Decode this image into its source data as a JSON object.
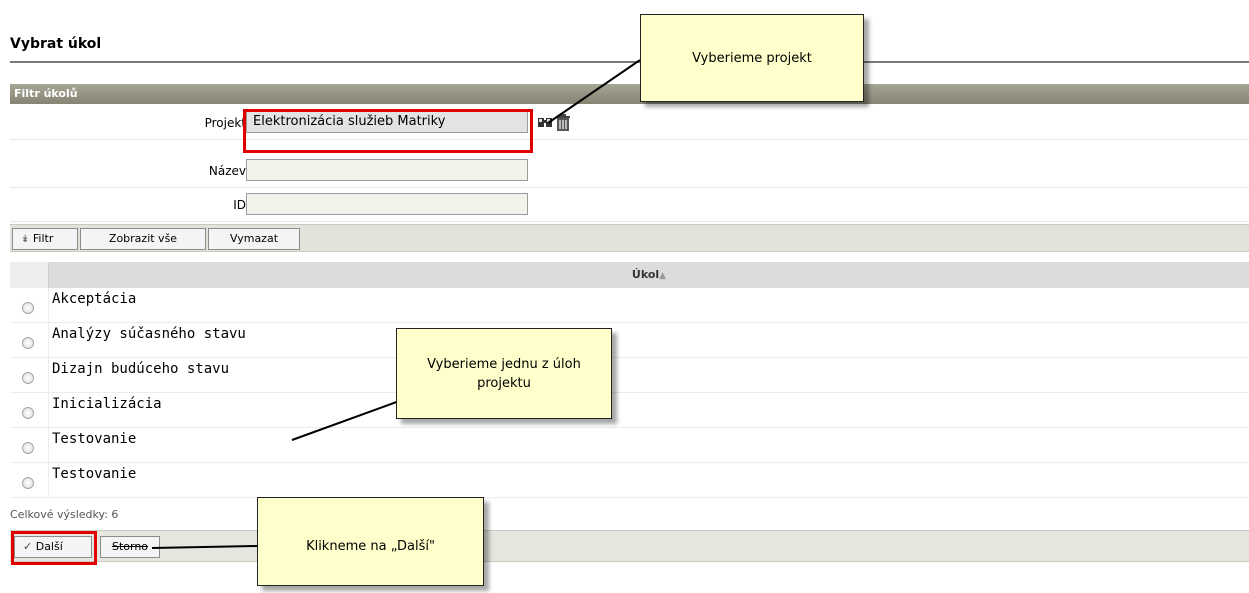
{
  "page": {
    "title": "Vybrat úkol"
  },
  "filter": {
    "header": "Filtr úkolů",
    "fields": [
      {
        "label": "Projekt",
        "value": "Elektronizácia služieb Matriky"
      },
      {
        "label": "Název",
        "value": ""
      },
      {
        "label": "ID",
        "value": ""
      }
    ],
    "buttons": {
      "filter": "Filtr",
      "show_all": "Zobrazit vše",
      "clear": "Vymazat"
    }
  },
  "grid": {
    "column_header": "Úkol",
    "rows": [
      "Akceptácia",
      "Analýzy súčasného stavu",
      "Dizajn budúceho stavu",
      "Inicializácia",
      "Testovanie",
      "Testovanie"
    ]
  },
  "footer": {
    "total_label": "Celkové výsledky: 6",
    "next_label": "Další",
    "cancel_label": "Storno"
  },
  "callouts": {
    "project": "Vyberieme projekt",
    "task": "Vyberieme jednu z úloh projektu",
    "next": "Klikneme na „Další\""
  },
  "colors": {
    "highlight": "#e00000",
    "callout_bg": "#ffffcc",
    "header_bg": "#908f7d"
  }
}
